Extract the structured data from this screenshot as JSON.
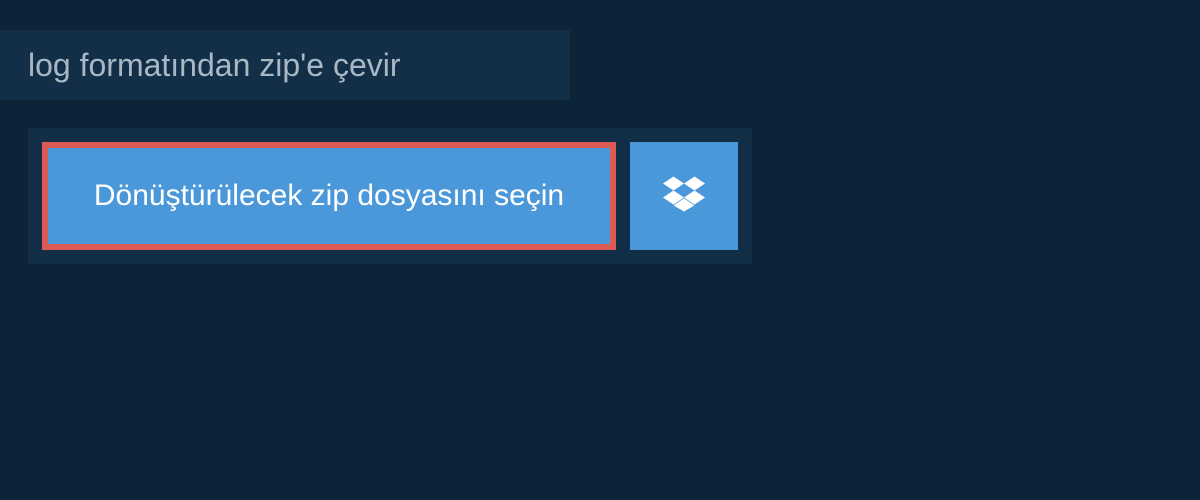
{
  "header": {
    "title": "log formatından zip'e çevir"
  },
  "upload": {
    "select_file_label": "Dönüştürülecek zip dosyasını seçin",
    "dropbox_icon_name": "dropbox-icon"
  },
  "colors": {
    "background": "#0d2438",
    "panel": "#132e47",
    "button_primary": "#4a98da",
    "button_highlight_border": "#dc5a56",
    "text_muted": "#a8b8c4",
    "text_white": "#ffffff"
  }
}
